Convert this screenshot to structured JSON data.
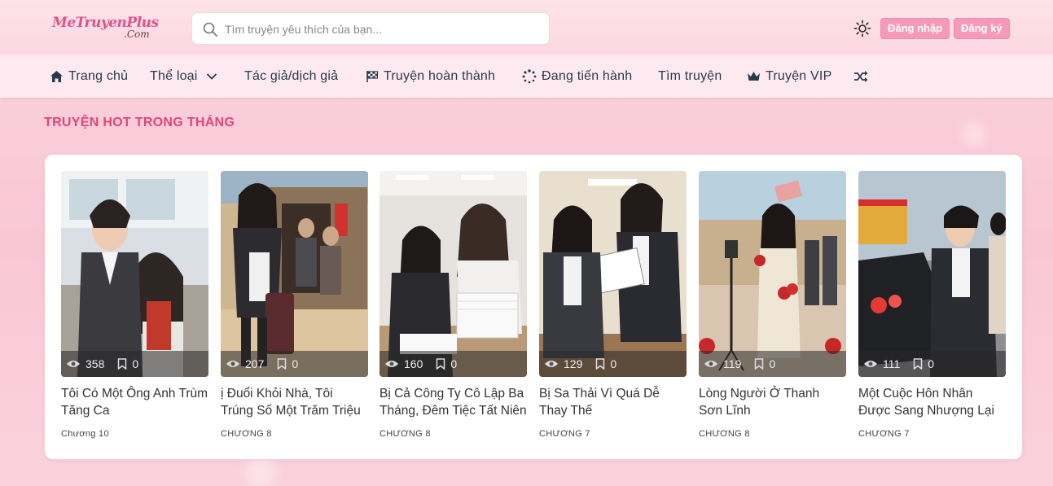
{
  "header": {
    "logo_main": "MeTruyenPlus",
    "logo_sub": ".Com",
    "search_placeholder": "Tìm truyện yêu thích của bạn...",
    "login_label": "Đăng nhập",
    "register_label": "Đăng ký"
  },
  "nav": {
    "items": [
      {
        "label": "Trang chủ",
        "icon": "home-icon"
      },
      {
        "label": "Thể loại",
        "icon": "chevron-down-icon"
      },
      {
        "label": "Tác giả/dịch giả",
        "icon": ""
      },
      {
        "label": "Truyện hoàn thành",
        "icon": "flag-icon"
      },
      {
        "label": "Đang tiến hành",
        "icon": "spinner-icon"
      },
      {
        "label": "Tìm truyện",
        "icon": ""
      },
      {
        "label": "Truyện VIP",
        "icon": "crown-icon"
      },
      {
        "label": "",
        "icon": "shuffle-icon"
      }
    ]
  },
  "section": {
    "title": "TRUYỆN HOT TRONG THÁNG"
  },
  "stories": [
    {
      "title": "Tôi Có Một Ông Anh Trùm Tăng Ca",
      "views": "358",
      "bookmarks": "0",
      "chapter": "Chương 10"
    },
    {
      "title": "ị Đuổi Khỏi Nhà, Tôi Trúng Số Một Trăm Triệu",
      "views": "207",
      "bookmarks": "0",
      "chapter": "CHƯƠNG 8"
    },
    {
      "title": "Bị Cả Công Ty Cô Lập Ba Tháng, Đêm Tiệc Tất Niên",
      "views": "160",
      "bookmarks": "0",
      "chapter": "CHƯƠNG 8"
    },
    {
      "title": "Bị Sa Thải Vì Quá Dễ Thay Thế",
      "views": "129",
      "bookmarks": "0",
      "chapter": "CHƯƠNG 7"
    },
    {
      "title": "Lòng Người Ở Thanh Sơn Lĩnh",
      "views": "119",
      "bookmarks": "0",
      "chapter": "CHƯƠNG 8"
    },
    {
      "title": "Một Cuộc Hôn Nhân Được Sang Nhượng Lại",
      "views": "111",
      "bookmarks": "0",
      "chapter": "CHƯƠNG 7"
    }
  ],
  "colors": {
    "accent": "#e0457b",
    "button": "#f59ab8",
    "nav_text": "#2b3a4a"
  }
}
